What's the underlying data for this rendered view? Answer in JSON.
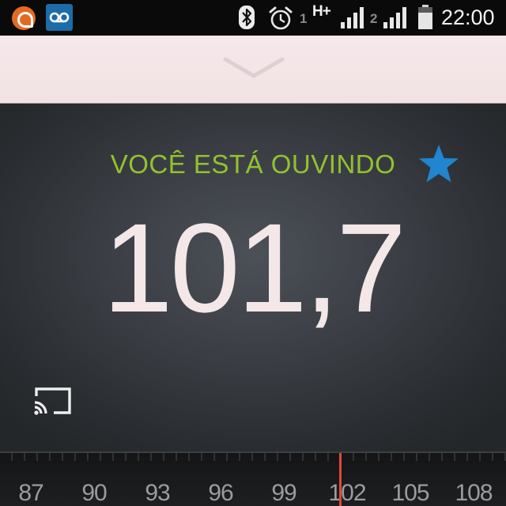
{
  "status_bar": {
    "notifications": [
      "app-notification-icon",
      "voicemail-icon"
    ],
    "icons": [
      "bluetooth-icon",
      "alarm-icon",
      "signal-icon",
      "battery-icon"
    ],
    "sim1_label": "1",
    "sim2_label": "2",
    "network_type": "H+",
    "time": "22:00"
  },
  "player": {
    "listening_label": "VOCÊ ESTÁ OUVINDO",
    "frequency": "101,7",
    "favorite_icon": "star-icon",
    "cast_icon": "cast-icon",
    "colors": {
      "accent_green": "#93c22e",
      "favorite_blue": "#1f86cf",
      "needle_red": "#e0483c"
    }
  },
  "dial": {
    "labels": [
      "87",
      "90",
      "93",
      "96",
      "99",
      "102",
      "105",
      "108"
    ],
    "current_frequency_mhz": 101.7
  }
}
